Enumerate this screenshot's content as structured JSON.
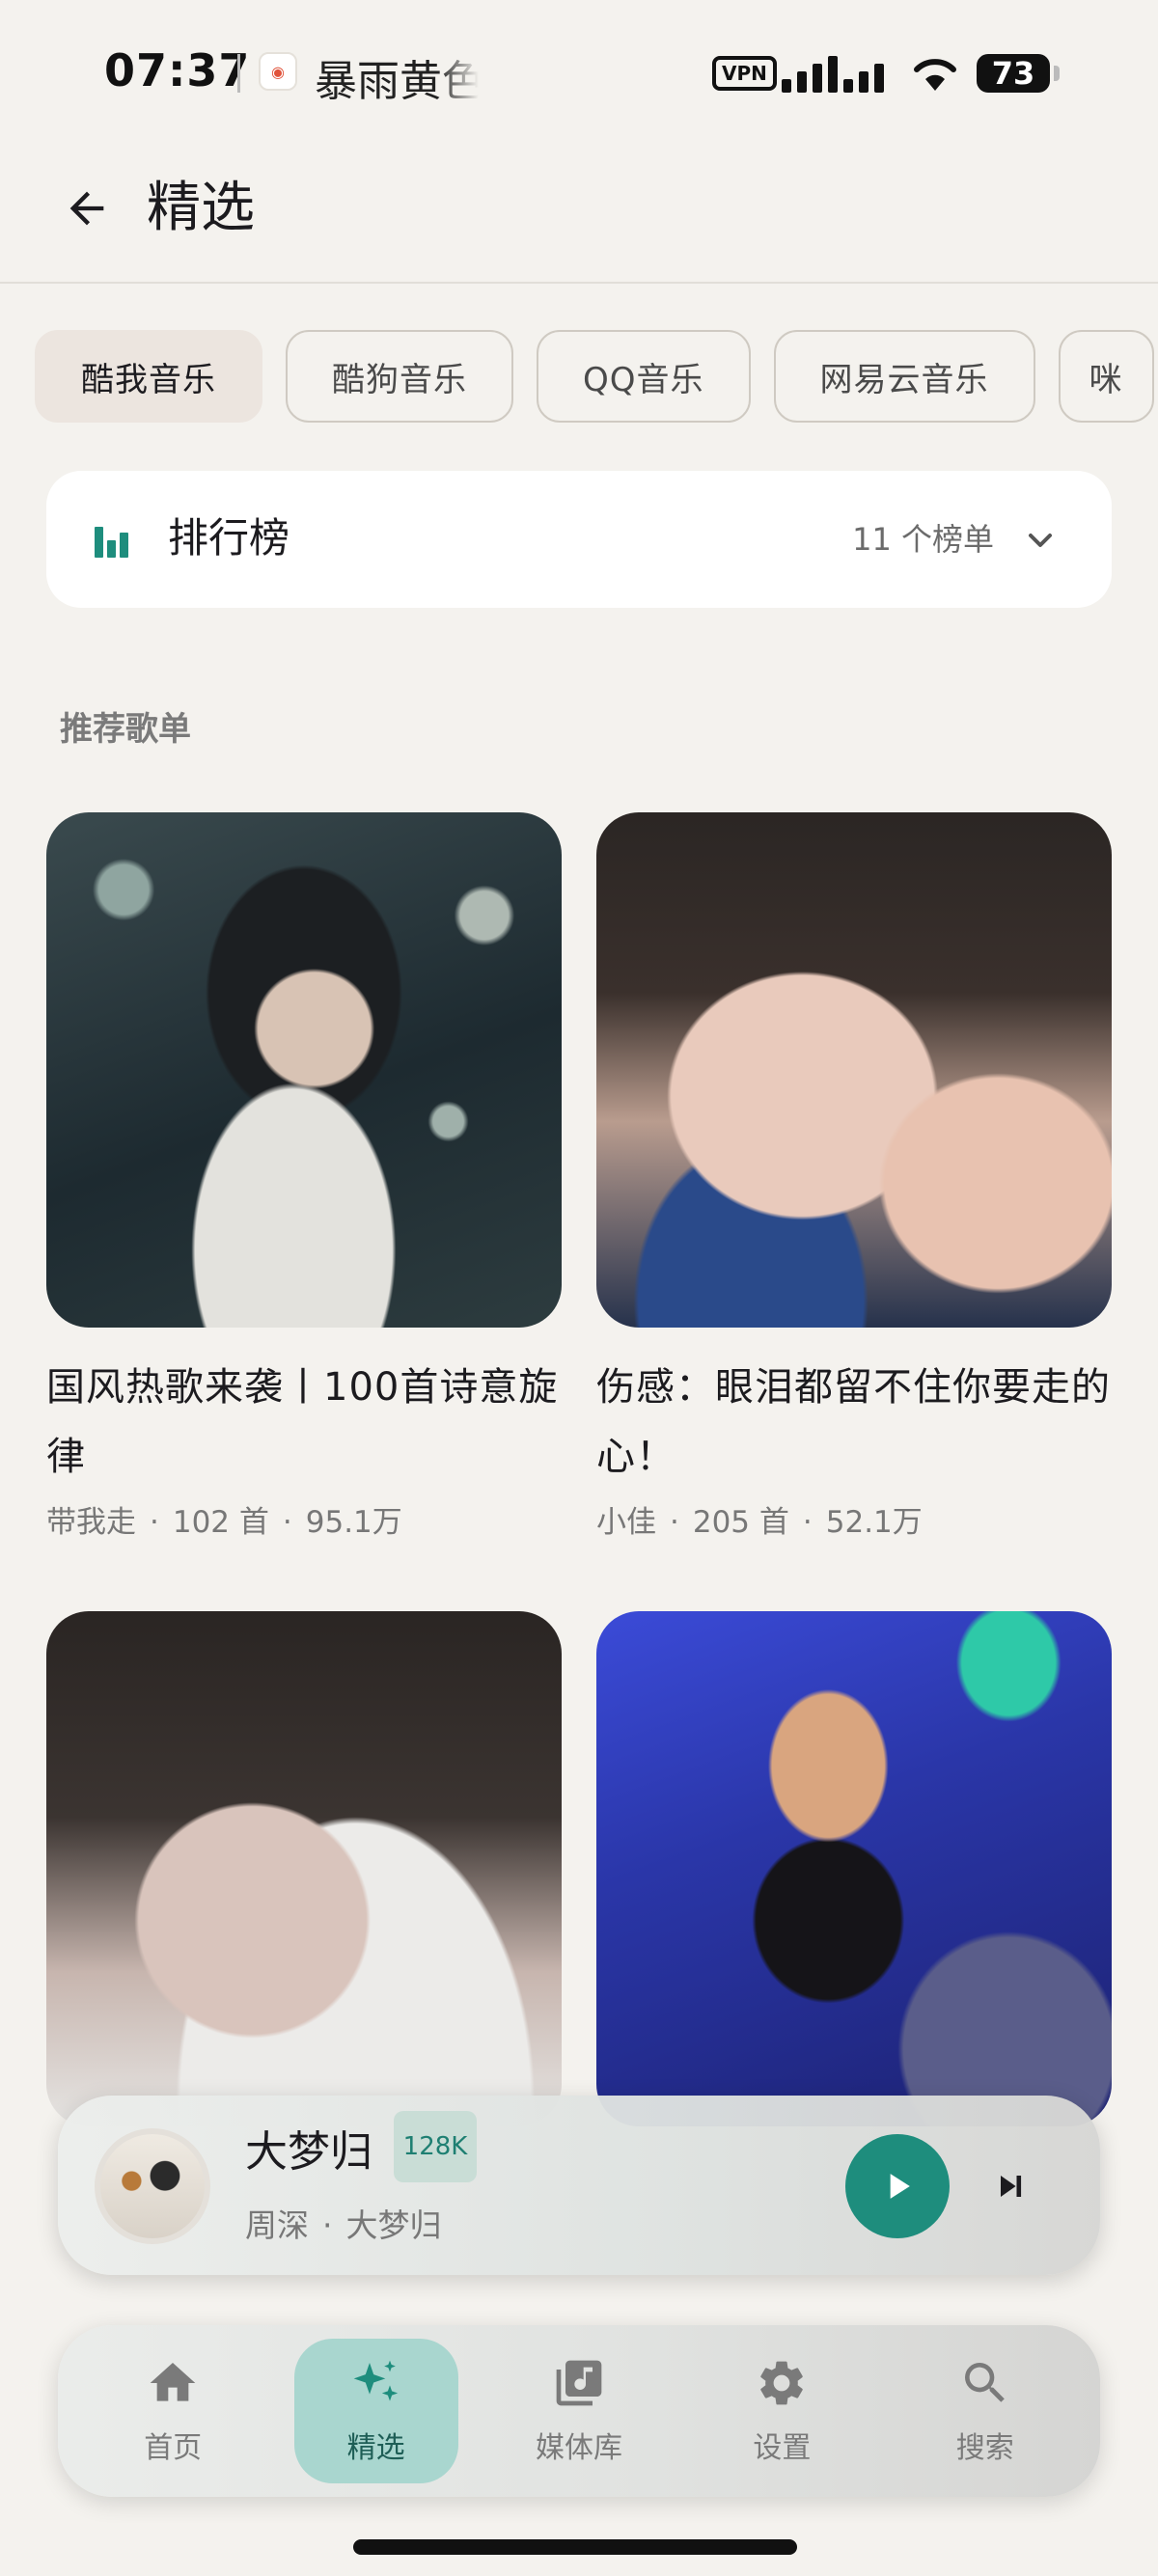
{
  "status_bar": {
    "time": "07:37",
    "app_badge": "⚫",
    "notification_text": "暴雨黄色",
    "vpn": "VPN",
    "battery": "73"
  },
  "app_bar": {
    "back_icon": "arrow-left-icon",
    "title": "精选"
  },
  "chips": [
    {
      "label": "酷我音乐",
      "active": true
    },
    {
      "label": "酷狗音乐",
      "active": false
    },
    {
      "label": "QQ音乐",
      "active": false
    },
    {
      "label": "网易云音乐",
      "active": false
    },
    {
      "label": "咪",
      "active": false
    }
  ],
  "rank_card": {
    "icon": "bar-chart-icon",
    "title": "排行榜",
    "count": "11 个榜单",
    "chevron": "chevron-down-icon"
  },
  "section": {
    "title": "推荐歌单"
  },
  "playlists": [
    {
      "title": "国风热歌来袭丨100首诗意旋律",
      "creator": "带我走",
      "songs": "102 首",
      "plays": "95.1万"
    },
    {
      "title": "伤感：眼泪都留不住你要走的心！",
      "creator": "小佳",
      "songs": "205 首",
      "plays": "52.1万"
    },
    {
      "title": "",
      "creator": "",
      "songs": "",
      "plays": ""
    },
    {
      "title": "",
      "creator": "",
      "songs": "",
      "plays": ""
    }
  ],
  "mini_player": {
    "title": "大梦归",
    "quality": "128K",
    "artist": "周深",
    "album": "大梦归",
    "play_icon": "play-icon",
    "next_icon": "skip-next-icon"
  },
  "bottom_nav": [
    {
      "label": "首页",
      "icon": "home-icon",
      "active": false
    },
    {
      "label": "精选",
      "icon": "sparkle-icon",
      "active": true
    },
    {
      "label": "媒体库",
      "icon": "library-icon",
      "active": false
    },
    {
      "label": "设置",
      "icon": "gear-icon",
      "active": false
    },
    {
      "label": "搜索",
      "icon": "search-icon",
      "active": false
    }
  ],
  "colors": {
    "accent": "#1e8d7d",
    "background": "#f4f2ee",
    "nav_active": "#a9d6cf"
  }
}
